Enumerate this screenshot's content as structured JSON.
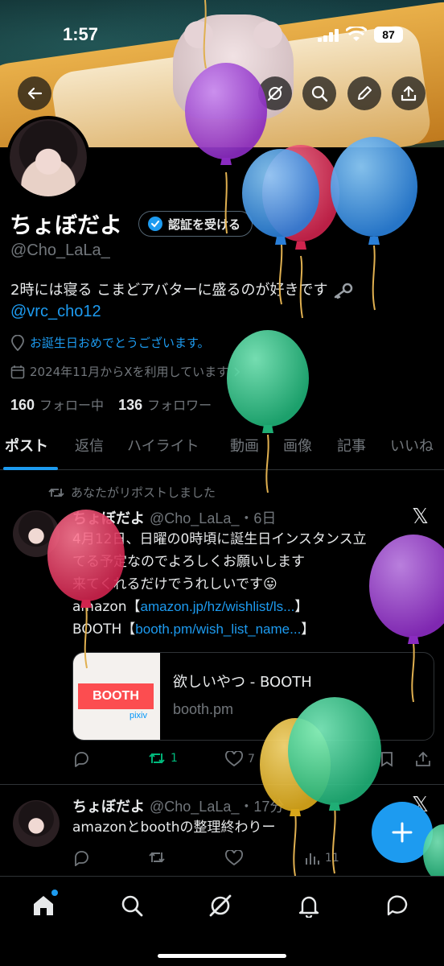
{
  "status_bar": {
    "time": "1:57",
    "battery": "87"
  },
  "profile": {
    "display_name": "ちょぼだよ",
    "verify_label": "認証を受ける",
    "handle": "@Cho_LaLa_",
    "bio": "2時には寝る こまどアバターに盛るのが好きです",
    "bio_link": "@vrc_cho12",
    "birthday": "お誕生日おめでとうございます。",
    "joined": "2024年11月からXを利用しています",
    "following_count": "160",
    "following_label": "フォロー中",
    "followers_count": "136",
    "followers_label": "フォロワー"
  },
  "tabs": [
    "ポスト",
    "返信",
    "ハイライト",
    "動画",
    "画像",
    "記事",
    "いいね"
  ],
  "posts": [
    {
      "repost_note": "あなたがリポストしました",
      "name": "ちょぼだよ",
      "handle_time": "@Cho_LaLa_・6日",
      "line1": "4月12日、日曜の0時頃に誕生日インスタンス立",
      "line2": "てる予定なのでよろしくお願いします",
      "line3": "来てくれるだけでうれしいです😛",
      "amazon_prefix": "amazon【",
      "amazon_link": "amazon.jp/hz/wishlist/ls...",
      "booth_prefix": "BOOTH【",
      "booth_link": "booth.pm/wish_list_name...",
      "bracket_close": "】",
      "card": {
        "logo": "BOOTH",
        "logo_sub": "pixiv",
        "title": "欲しいやつ - BOOTH",
        "domain": "booth.pm"
      },
      "retweets": "1",
      "likes": "7"
    },
    {
      "name": "ちょぼだよ",
      "handle_time": "@Cho_LaLa_・17分",
      "text": "amazonとboothの整理終わりー",
      "views": "11"
    }
  ],
  "colors": {
    "accent": "#1d9bf0",
    "repost_green": "#00ba7c",
    "muted": "#71767b"
  },
  "icons": [
    "back-arrow-icon",
    "grok-icon",
    "search-icon",
    "pencil-icon",
    "share-icon",
    "verified-badge-icon",
    "location-pin-icon",
    "calendar-icon",
    "key-emoji-icon",
    "retweet-icon",
    "reply-icon",
    "like-icon",
    "views-icon",
    "bookmark-icon",
    "x-logo-icon",
    "plus-icon",
    "home-icon",
    "bell-icon",
    "messages-icon"
  ]
}
